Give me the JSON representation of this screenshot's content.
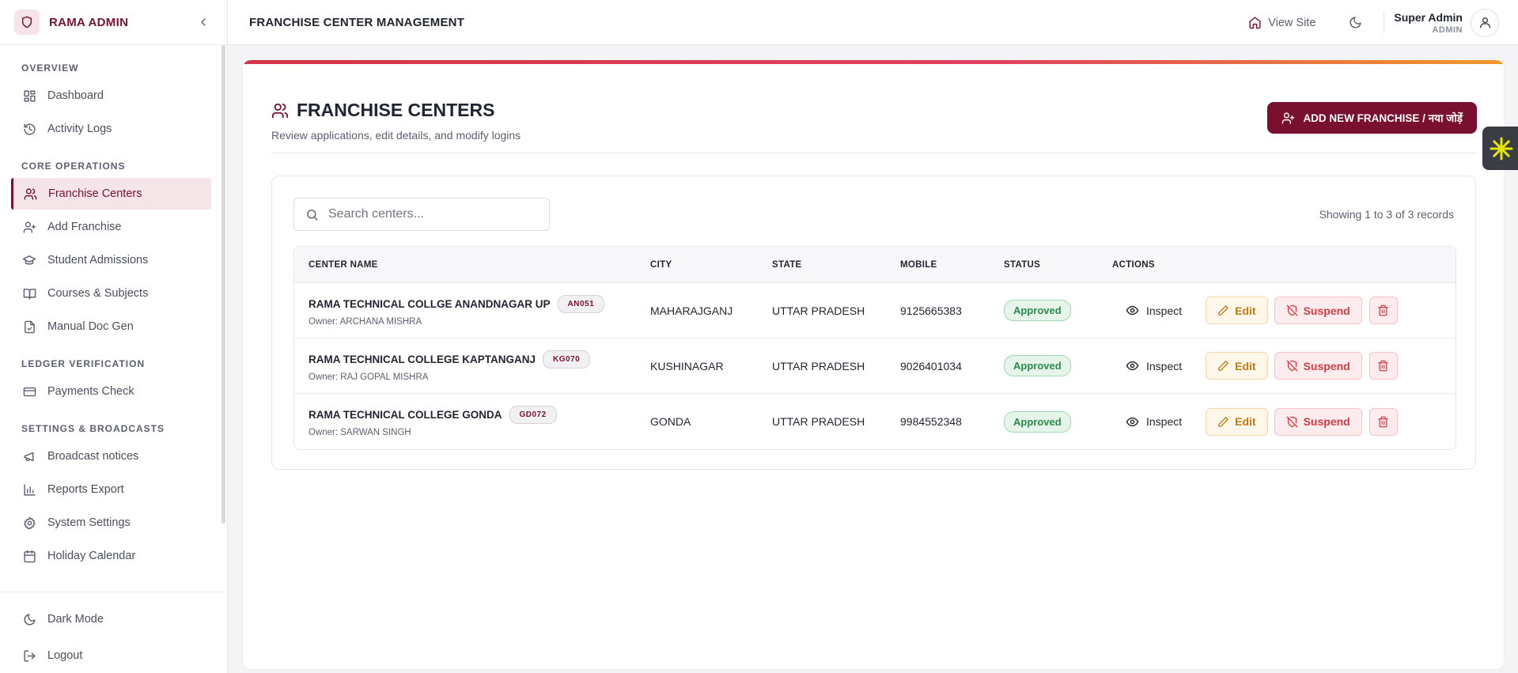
{
  "brand": {
    "name": "RAMA ADMIN"
  },
  "sidebar": {
    "sections": [
      {
        "title": "OVERVIEW",
        "items": [
          {
            "label": "Dashboard",
            "icon": "dashboard-icon"
          },
          {
            "label": "Activity Logs",
            "icon": "history-icon"
          }
        ]
      },
      {
        "title": "CORE OPERATIONS",
        "items": [
          {
            "label": "Franchise Centers",
            "icon": "users-icon",
            "active": true
          },
          {
            "label": "Add Franchise",
            "icon": "user-plus-icon"
          },
          {
            "label": "Student Admissions",
            "icon": "graduation-cap-icon"
          },
          {
            "label": "Courses & Subjects",
            "icon": "book-icon"
          },
          {
            "label": "Manual Doc Gen",
            "icon": "file-icon"
          }
        ]
      },
      {
        "title": "LEDGER VERIFICATION",
        "items": [
          {
            "label": "Payments Check",
            "icon": "credit-card-icon"
          }
        ]
      },
      {
        "title": "SETTINGS & BROADCASTS",
        "items": [
          {
            "label": "Broadcast notices",
            "icon": "megaphone-icon"
          },
          {
            "label": "Reports Export",
            "icon": "bar-chart-icon"
          },
          {
            "label": "System Settings",
            "icon": "gear-icon"
          },
          {
            "label": "Holiday Calendar",
            "icon": "calendar-icon"
          }
        ]
      }
    ],
    "bottom": [
      {
        "label": "Dark Mode",
        "icon": "moon-icon"
      },
      {
        "label": "Logout",
        "icon": "logout-icon"
      }
    ]
  },
  "topbar": {
    "title": "FRANCHISE CENTER MANAGEMENT",
    "view_site": "View Site",
    "user_name": "Super Admin",
    "user_role": "ADMIN"
  },
  "page": {
    "title": "FRANCHISE CENTERS",
    "subtitle": "Review applications, edit details, and modify logins",
    "add_button": "ADD NEW FRANCHISE / नया जोड़ें"
  },
  "search": {
    "placeholder": "Search centers..."
  },
  "records_text": "Showing 1 to 3 of 3 records",
  "table": {
    "headers": [
      "CENTER NAME",
      "CITY",
      "STATE",
      "MOBILE",
      "STATUS",
      "ACTIONS"
    ],
    "actions": {
      "inspect": "Inspect",
      "edit": "Edit",
      "suspend": "Suspend"
    },
    "rows": [
      {
        "name": "RAMA TECHNICAL COLLGE ANANDNAGAR UP",
        "code": "AN051",
        "owner": "Owner: ARCHANA MISHRA",
        "city": "MAHARAJGANJ",
        "state": "UTTAR PRADESH",
        "mobile": "9125665383",
        "status": "Approved"
      },
      {
        "name": "RAMA TECHNICAL COLLEGE KAPTANGANJ",
        "code": "KG070",
        "owner": "Owner: RAJ GOPAL MISHRA",
        "city": "KUSHINAGAR",
        "state": "UTTAR PRADESH",
        "mobile": "9026401034",
        "status": "Approved"
      },
      {
        "name": "RAMA TECHNICAL COLLEGE GONDA",
        "code": "GD072",
        "owner": "Owner: SARWAN SINGH",
        "city": "GONDA",
        "state": "UTTAR PRADESH",
        "mobile": "9984552348",
        "status": "Approved"
      }
    ]
  },
  "colors": {
    "brand": "#7a1030",
    "approved": "#2a8a4a",
    "edit": "#c07a14",
    "danger": "#d83a44"
  }
}
